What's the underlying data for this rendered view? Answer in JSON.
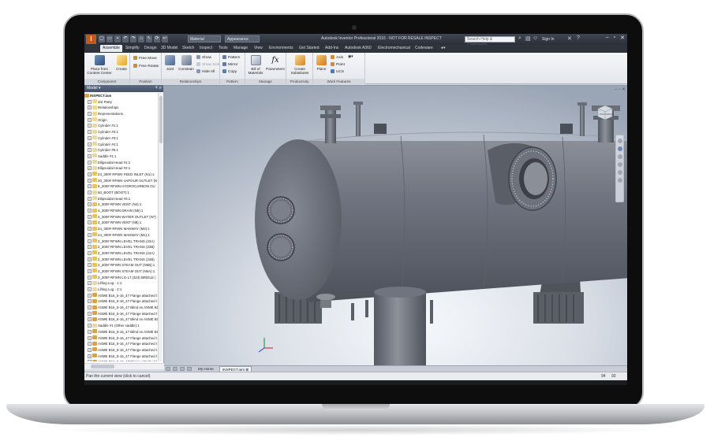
{
  "titlebar": {
    "app_letter": "I",
    "material_combo": "Material",
    "appearance_combo": "Appearance",
    "title": "Autodesk Inventor Professional 2016 - NOT FOR RESALE   INSPECT",
    "search_placeholder": "Search Help & Commands...",
    "sign_in": "Sign In"
  },
  "ribbon_tabs": [
    "Assemble",
    "Simplify",
    "Design",
    "3D Model",
    "Sketch",
    "Inspect",
    "Tools",
    "Manage",
    "View",
    "Environments",
    "Get Started",
    "Add-Ins",
    "Autodesk A360",
    "Electromechanical",
    "Codeware"
  ],
  "ribbon": {
    "component": {
      "label": "Component",
      "place": "Place from Content Center",
      "create": "Create"
    },
    "position": {
      "label": "Position",
      "free_move": "Free Move",
      "free_rotate": "Free Rotate"
    },
    "relationships": {
      "label": "Relationships",
      "joint": "Joint",
      "constrain": "Constrain",
      "show": "Show",
      "show_sick": "Show Sick",
      "hide_all": "Hide All"
    },
    "pattern": {
      "label": "Pattern",
      "pattern": "Pattern",
      "mirror": "Mirror",
      "copy": "Copy"
    },
    "manage": {
      "label": "Manage",
      "bom": "Bill of Materials",
      "parameters": "Parameters"
    },
    "productivity": {
      "label": "Productivity",
      "create_substitutes": "Create Substitutes"
    },
    "work_features": {
      "label": "Work Features",
      "plane": "Plane",
      "axis": "Axis",
      "point": "Point",
      "ucs": "UCS"
    }
  },
  "browser": {
    "title": "Model",
    "root": "INSPECT.iam",
    "nodes": [
      "3rd Party",
      "Relationships",
      "Representations",
      "Origin",
      "Cylinder #1:1",
      "Cylinder #2:1",
      "Cylinder #3:1",
      "Cylinder #4:1",
      "Cylinder #5:1",
      "Saddle #1:1",
      "Ellipsoidal Head #1:1",
      "Ellipsoidal Head #2:1",
      "24_300# RFWN FEED INLET (N1):1",
      "20_300# RFWN VAPOUR OUTLET (N",
      "8_300# RFWN HYDROCARBON OU",
      "60_BOOT (BOOT):1",
      "Ellipsoidal Head #3:1",
      "4_300# RFWN VENT (N4):1",
      "4_300# RFWN DRAIN (N5):1",
      "4_300# RFWN WATER OUTLET (N7)",
      "4_300# RFWN VENT (N8):1",
      "24_300# RFWN MANWAY (M2):1",
      "24_300# RFWN MANWAY (M1):1",
      "2_300# RFWN LEVEL TRANS (23A)",
      "2_300# RFWN LEVEL TRANS (23B)",
      "2_300# RFWN LEVEL TRANS (24A)",
      "2_300# RFWN LEVEL TRANS (24B)",
      "2_300# RFWN STEAM OUT (N6B):1",
      "2_300# RFWN STEAM OUT (N6A):1",
      "3_300# RFWN LG-LT (323) BRIDLE (",
      "Lifting Lug - 1:1",
      "Lifting Lug - 2:1",
      "ASME B16_5-16_47 Flange attached t",
      "ASME B16_5-16_47 Flange attached t",
      "ASME B16_5-16_47 Blind on ASME B1",
      "ASME B16_5-16_47 Flange attached t",
      "ASME B16_5-16_47 Blind on ASME B1",
      "Saddle #1 (Other saddle):1",
      "ASME B16_5-16_47 Blind on ASME B1",
      "ASME B16_5-16_47 Flange attached t",
      "ASME B16_5-16_47 Flange attached t",
      "ASME B16_5-16_47 Flange attached t",
      "ASME B16_5-16_47 Flange attached t",
      "ASME B16_5-16_47 Flange attached t"
    ]
  },
  "doc_tabs": {
    "home": "My Home",
    "active": "INSPECT.iam"
  },
  "status": {
    "message": "Pan the current view (click to cancel)",
    "count_a": "94",
    "count_b": "93"
  },
  "viewcube": {
    "front": "FRONT",
    "right": "RIGHT"
  },
  "colors": {
    "accent": "#c4581d",
    "vessel": "#6b6f78",
    "ribbon_bg": "#e9ecf1"
  }
}
